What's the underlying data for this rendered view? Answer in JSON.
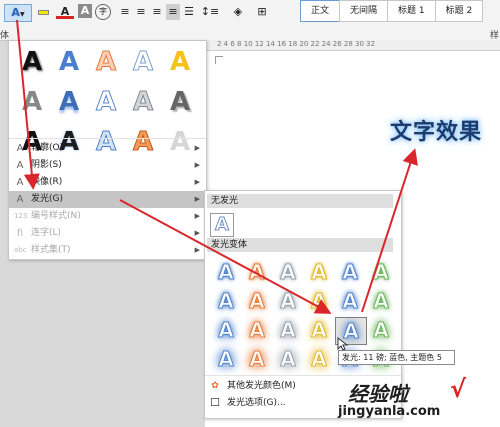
{
  "ribbon": {
    "text_effects_glyph": "A",
    "font_color_glyph": "A",
    "char_shading_glyph": "A",
    "enclose_glyph": "字",
    "left_cut": "体",
    "right_cut": "样",
    "styles": [
      "正文",
      "无间隔",
      "标题 1",
      "标题 2"
    ]
  },
  "ruler": {
    "text": "2  4  6  8  10  12  14  16  18  20  22  24  26  28  30  32"
  },
  "document": {
    "effect_text": "文字效果"
  },
  "text_effects_menu": {
    "gallery_glyph": "A",
    "items": [
      {
        "icon": "A",
        "label": "轮廓(O)",
        "arrow": "▶",
        "enabled": true
      },
      {
        "icon": "A",
        "label": "阴影(S)",
        "arrow": "▶",
        "enabled": true
      },
      {
        "icon": "A",
        "label": "映像(R)",
        "arrow": "▶",
        "enabled": true
      },
      {
        "icon": "A",
        "label": "发光(G)",
        "arrow": "▶",
        "enabled": true,
        "highlighted": true
      },
      {
        "icon": "123",
        "label": "编号样式(N)",
        "arrow": "▶",
        "enabled": false
      },
      {
        "icon": "fi",
        "label": "连字(L)",
        "arrow": "▶",
        "enabled": false
      },
      {
        "icon": "abc",
        "label": "样式集(T)",
        "arrow": "▶",
        "enabled": false
      }
    ]
  },
  "glow_submenu": {
    "no_glow_title": "无发光",
    "variants_title": "发光变体",
    "glyph": "A",
    "tooltip": "发光: 11 磅; 蓝色, 主题色 5",
    "more_colors": "其他发光颜色(M)",
    "options": "发光选项(G)..."
  },
  "watermark": {
    "main": "经验啦",
    "sub": "jingyanla.com",
    "check": "√"
  },
  "colors": {
    "accent": "#d9262b",
    "ribbon": "#f3f3f3",
    "highlight": "#c5c5c5",
    "glow_blue": "#76b8f2"
  }
}
